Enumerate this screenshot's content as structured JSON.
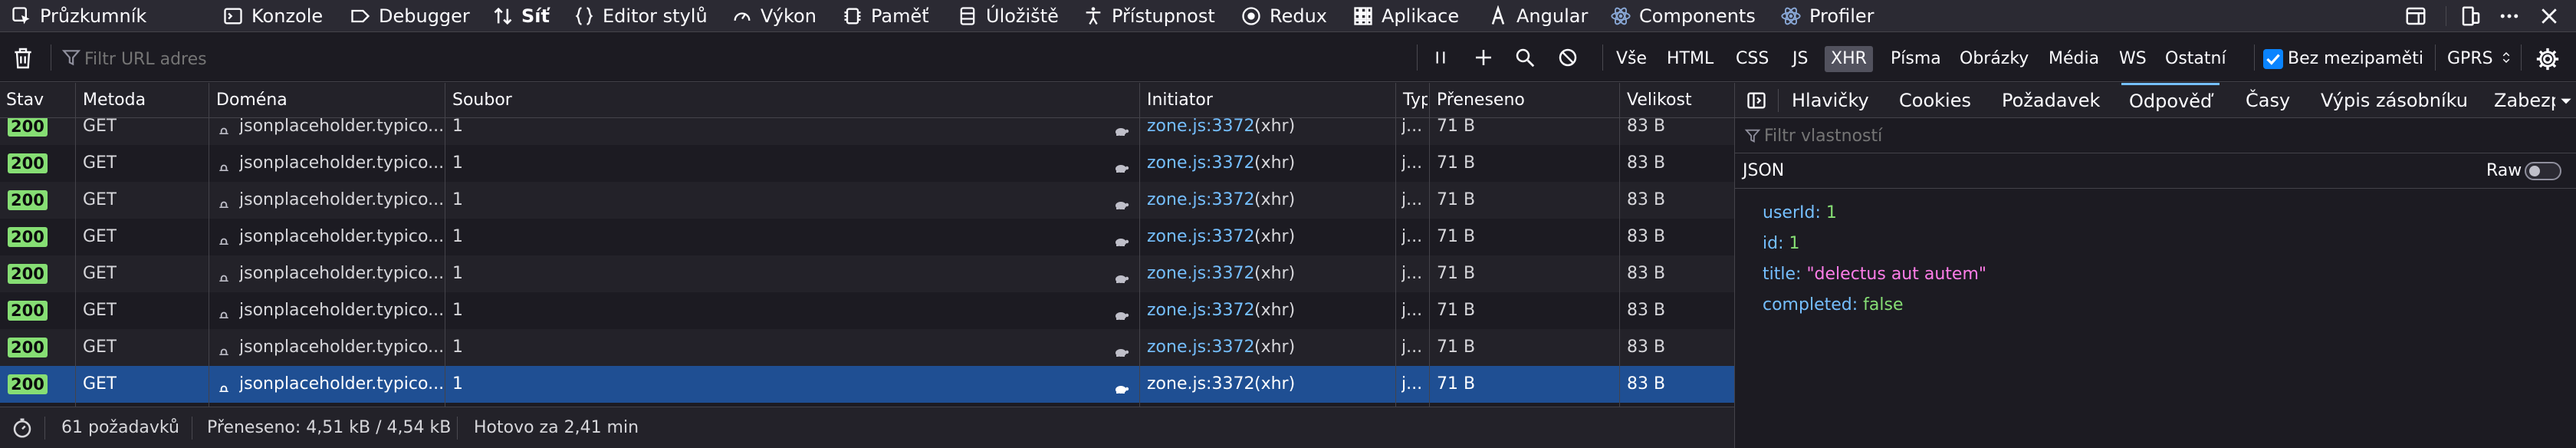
{
  "toolbar": {
    "tools": [
      {
        "label": "Průzkumník",
        "icon": "inspector-icon"
      },
      {
        "label": "Konzole",
        "icon": "console-icon"
      },
      {
        "label": "Debugger",
        "icon": "debugger-icon"
      },
      {
        "label": "Síť",
        "icon": "network-icon"
      },
      {
        "label": "Editor stylů",
        "icon": "style-editor-icon"
      },
      {
        "label": "Výkon",
        "icon": "performance-icon"
      },
      {
        "label": "Paměť",
        "icon": "memory-icon"
      },
      {
        "label": "Úložiště",
        "icon": "storage-icon"
      },
      {
        "label": "Přístupnost",
        "icon": "accessibility-icon"
      },
      {
        "label": "Redux",
        "icon": "redux-icon"
      },
      {
        "label": "Aplikace",
        "icon": "application-icon"
      },
      {
        "label": "Angular",
        "icon": "angular-icon"
      },
      {
        "label": "Components",
        "icon": "react-icon"
      },
      {
        "label": "Profiler",
        "icon": "react-icon"
      }
    ]
  },
  "filterbar": {
    "placeholder": "Filtr URL adres",
    "types": [
      "Vše",
      "HTML",
      "CSS",
      "JS",
      "XHR",
      "Písma",
      "Obrázky",
      "Média",
      "WS",
      "Ostatní"
    ],
    "selected_type": "XHR",
    "no_cache_label": "Bez mezipaměti",
    "throttle_label": "GPRS"
  },
  "table": {
    "headers": {
      "status": "Stav",
      "method": "Metoda",
      "domain": "Doména",
      "file": "Soubor",
      "initiator": "Initiator",
      "type": "Typ",
      "transferred": "Přeneseno",
      "size": "Velikost"
    },
    "rows": [
      {
        "status": "200",
        "method": "GET",
        "domain": "jsonplaceholder.typico...",
        "file": "1",
        "initiator_link": "zone.js:3372",
        "initiator_suffix": "(xhr)",
        "type": "j...",
        "transferred": "71 B",
        "size": "83 B"
      },
      {
        "status": "200",
        "method": "GET",
        "domain": "jsonplaceholder.typico...",
        "file": "1",
        "initiator_link": "zone.js:3372",
        "initiator_suffix": "(xhr)",
        "type": "j...",
        "transferred": "71 B",
        "size": "83 B"
      },
      {
        "status": "200",
        "method": "GET",
        "domain": "jsonplaceholder.typico...",
        "file": "1",
        "initiator_link": "zone.js:3372",
        "initiator_suffix": "(xhr)",
        "type": "j...",
        "transferred": "71 B",
        "size": "83 B"
      },
      {
        "status": "200",
        "method": "GET",
        "domain": "jsonplaceholder.typico...",
        "file": "1",
        "initiator_link": "zone.js:3372",
        "initiator_suffix": "(xhr)",
        "type": "j...",
        "transferred": "71 B",
        "size": "83 B"
      },
      {
        "status": "200",
        "method": "GET",
        "domain": "jsonplaceholder.typico...",
        "file": "1",
        "initiator_link": "zone.js:3372",
        "initiator_suffix": "(xhr)",
        "type": "j...",
        "transferred": "71 B",
        "size": "83 B"
      },
      {
        "status": "200",
        "method": "GET",
        "domain": "jsonplaceholder.typico...",
        "file": "1",
        "initiator_link": "zone.js:3372",
        "initiator_suffix": "(xhr)",
        "type": "j...",
        "transferred": "71 B",
        "size": "83 B"
      },
      {
        "status": "200",
        "method": "GET",
        "domain": "jsonplaceholder.typico...",
        "file": "1",
        "initiator_link": "zone.js:3372",
        "initiator_suffix": "(xhr)",
        "type": "j...",
        "transferred": "71 B",
        "size": "83 B"
      },
      {
        "status": "200",
        "method": "GET",
        "domain": "jsonplaceholder.typico...",
        "file": "1",
        "initiator_link": "zone.js:3372",
        "initiator_suffix": "(xhr)",
        "type": "j...",
        "transferred": "71 B",
        "size": "83 B"
      }
    ]
  },
  "statusbar": {
    "requests": "61 požadavků",
    "transferred": "Přeneseno: 4,51 kB / 4,54 kB",
    "finished": "Hotovo za 2,41 min"
  },
  "panel": {
    "tabs": [
      "Hlavičky",
      "Cookies",
      "Požadavek",
      "Odpověď",
      "Časy",
      "Výpis zásobníku",
      "Zabezp"
    ],
    "selected_tab": "Odpověď",
    "filter_placeholder": "Filtr vlastností",
    "json_label": "JSON",
    "raw_label": "Raw",
    "json": [
      {
        "key": "userId:",
        "value": "1",
        "kind": "num"
      },
      {
        "key": "id:",
        "value": "1",
        "kind": "num"
      },
      {
        "key": "title:",
        "value": "\"delectus aut autem\"",
        "kind": "str"
      },
      {
        "key": "completed:",
        "value": "false",
        "kind": "bool"
      }
    ]
  },
  "colors": {
    "accent": "#75bfff",
    "status_ok": "#86de74",
    "selected_row": "#1f4f93"
  }
}
